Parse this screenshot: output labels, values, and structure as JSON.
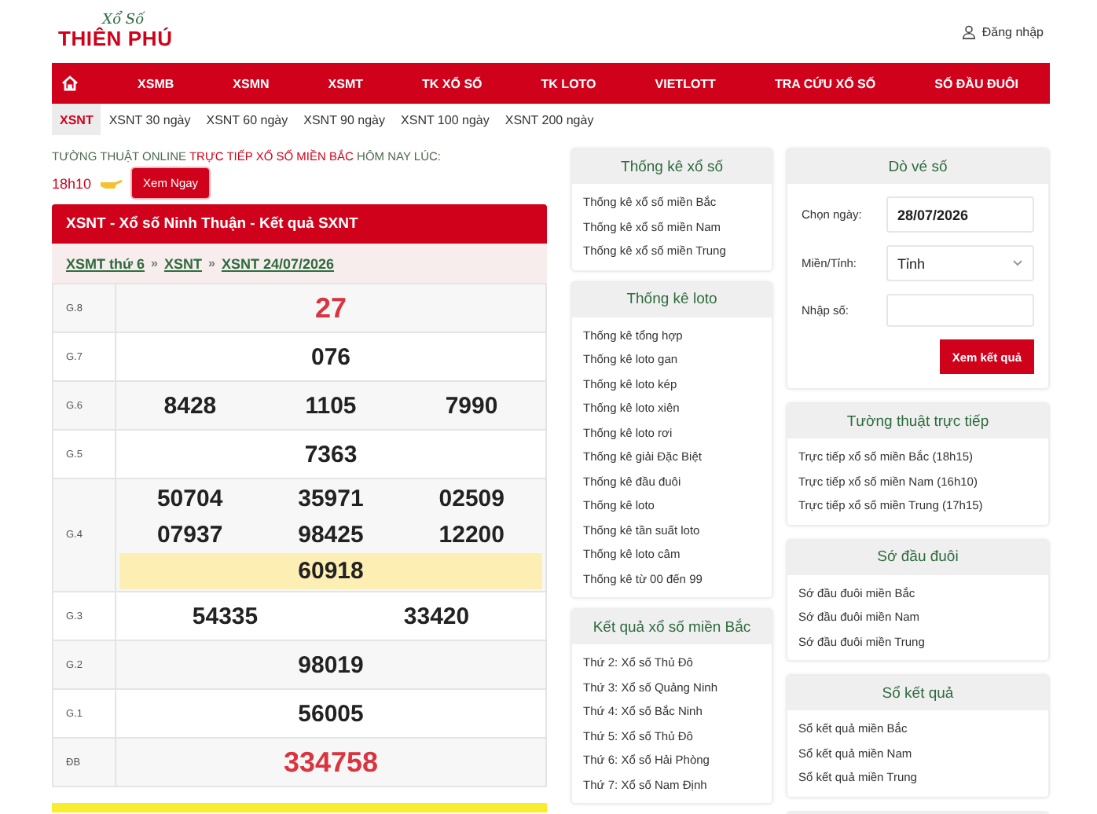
{
  "header": {
    "logo_top": "Xổ Số",
    "logo_main": "THIÊN PHÚ",
    "login": "Đăng nhập"
  },
  "nav": [
    {
      "label": "XSMB"
    },
    {
      "label": "XSMN"
    },
    {
      "label": "XSMT"
    },
    {
      "label": "TK XỔ SỐ"
    },
    {
      "label": "TK LOTO"
    },
    {
      "label": "VIETLOTT"
    },
    {
      "label": "TRA CỨU XỔ SỐ"
    },
    {
      "label": "SỐ ĐẦU ĐUÔI"
    }
  ],
  "subnav": [
    {
      "label": "XSNT",
      "selected": true
    },
    {
      "label": "XSNT 30 ngày",
      "selected": false
    },
    {
      "label": "XSNT 60 ngày",
      "selected": false
    },
    {
      "label": "XSNT 90 ngày",
      "selected": false
    },
    {
      "label": "XSNT 100 ngày",
      "selected": false
    },
    {
      "label": "XSNT 200 ngày",
      "selected": false
    }
  ],
  "live": {
    "segments": [
      {
        "text": "TƯỜNG THUẬT ONLINE",
        "color": "#4f6b4f"
      },
      {
        "text": "TRỰC TIẾP XỔ SỐ MIỀN BẮC",
        "color": "#d0021b"
      },
      {
        "text": "HÔM NAY LÚC:",
        "color": "#4f6b4f"
      }
    ],
    "time": "18h10",
    "button": "Xem Ngay"
  },
  "result": {
    "title": "XSNT - Xổ số Ninh Thuận - Kết quả SXNT",
    "breadcrumb": [
      "XSMT thứ 6",
      "XSNT",
      "XSNT 24/07/2026"
    ],
    "separator": "»",
    "prizes": [
      {
        "label": "G.8",
        "emphasis": true,
        "lines": [
          {
            "numbers": [
              "27"
            ],
            "highlighted": false
          }
        ]
      },
      {
        "label": "G.7",
        "emphasis": false,
        "lines": [
          {
            "numbers": [
              "076"
            ],
            "highlighted": false
          }
        ]
      },
      {
        "label": "G.6",
        "emphasis": false,
        "lines": [
          {
            "numbers": [
              "8428",
              "1105",
              "7990"
            ],
            "highlighted": false
          }
        ]
      },
      {
        "label": "G.5",
        "emphasis": false,
        "lines": [
          {
            "numbers": [
              "7363"
            ],
            "highlighted": false
          }
        ]
      },
      {
        "label": "G.4",
        "emphasis": false,
        "lines": [
          {
            "numbers": [
              "50704",
              "35971",
              "02509"
            ],
            "highlighted": false
          },
          {
            "numbers": [
              "07937",
              "98425",
              "12200"
            ],
            "highlighted": false
          },
          {
            "numbers": [
              "60918"
            ],
            "highlighted": true
          }
        ]
      },
      {
        "label": "G.3",
        "emphasis": false,
        "lines": [
          {
            "numbers": [
              "54335",
              "33420"
            ],
            "highlighted": false
          }
        ]
      },
      {
        "label": "G.2",
        "emphasis": false,
        "lines": [
          {
            "numbers": [
              "98019"
            ],
            "highlighted": false
          }
        ]
      },
      {
        "label": "G.1",
        "emphasis": false,
        "lines": [
          {
            "numbers": [
              "56005"
            ],
            "highlighted": false
          }
        ]
      },
      {
        "label": "ĐB",
        "emphasis": true,
        "lines": [
          {
            "numbers": [
              "334758"
            ],
            "highlighted": false
          }
        ]
      }
    ]
  },
  "middle_boxes": [
    {
      "title": "Thống kê xổ số",
      "items": [
        "Thống kê xổ số miền Bắc",
        "Thống kê xổ số miền Nam",
        "Thống kê xổ số miền Trung"
      ]
    },
    {
      "title": "Thống kê loto",
      "items": [
        "Thống kê tổng hợp",
        "Thống kê loto gan",
        "Thống kê loto kép",
        "Thống kê loto xiên",
        "Thống kê loto rơi",
        "Thống kê giải Đặc Biệt",
        "Thống kê đầu đuôi",
        "Thống kê loto",
        "Thống kê tần suất loto",
        "Thống kê loto câm",
        "Thống kê từ 00 đến 99"
      ]
    },
    {
      "title": "Kết quả xổ số miền Bắc",
      "items": [
        "Thứ 2: Xổ số Thủ Đô",
        "Thứ 3: Xổ số Quảng Ninh",
        "Thứ 4: Xổ số Bắc Ninh",
        "Thứ 5: Xổ số Thủ Đô",
        "Thứ 6: Xổ số Hải Phòng",
        "Thứ 7: Xổ số Nam Định"
      ]
    }
  ],
  "ticket_check": {
    "title": "Dò vé số",
    "date_label": "Chọn ngày:",
    "date_value": "28/07/2026",
    "region_label": "Miền/Tỉnh:",
    "region_value": "Tỉnh",
    "number_label": "Nhập số:",
    "button": "Xem kết quả"
  },
  "right_boxes": [
    {
      "title": "Tường thuật trực tiếp",
      "items": [
        "Trực tiếp xổ số miền Bắc (18h15)",
        "Trực tiếp xổ số miền Nam (16h10)",
        "Trực tiếp xổ số miền Trung (17h15)"
      ]
    },
    {
      "title": "Sớ đầu đuôi",
      "items": [
        "Sớ đầu đuôi miền Bắc",
        "Sớ đầu đuôi miền Nam",
        "Sớ đầu đuôi miền Trung"
      ]
    },
    {
      "title": "Sổ kết quả",
      "items": [
        "Sổ kết quả miền Bắc",
        "Sổ kết quả miền Nam",
        "Sổ kết quả miền Trung"
      ]
    }
  ]
}
